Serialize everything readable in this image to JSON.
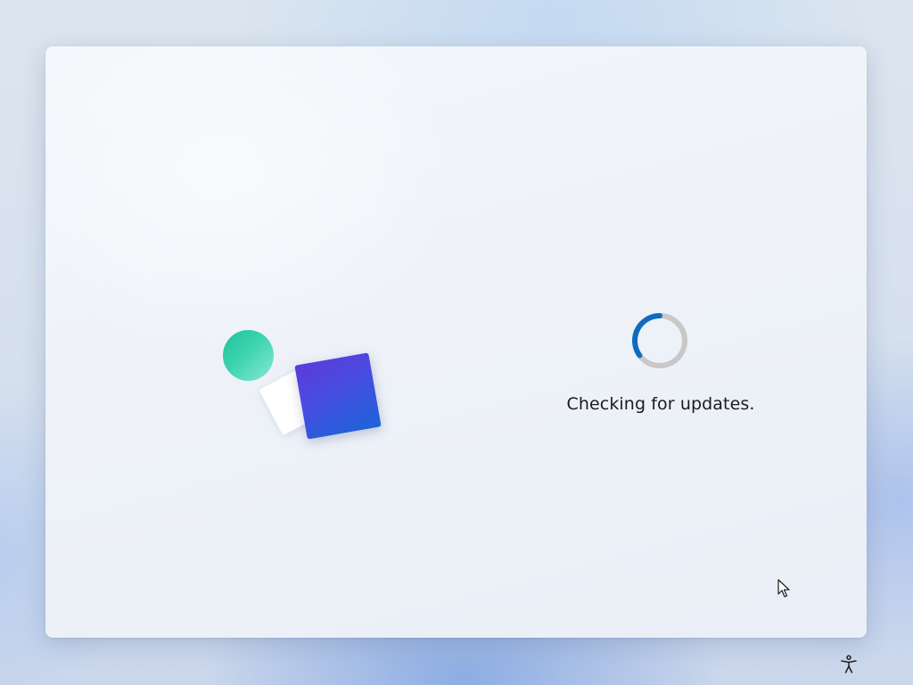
{
  "status": {
    "text": "Checking for updates."
  },
  "spinner": {
    "accent_color": "#0f6cbd",
    "track_color": "#c8c8c8"
  },
  "illustration": {
    "circle_color": "#2fcba6",
    "square_color": "#3b55dc",
    "card_color": "#ffffff"
  },
  "icons": {
    "accessibility": "accessibility-icon",
    "cursor": "mouse-pointer-icon"
  }
}
